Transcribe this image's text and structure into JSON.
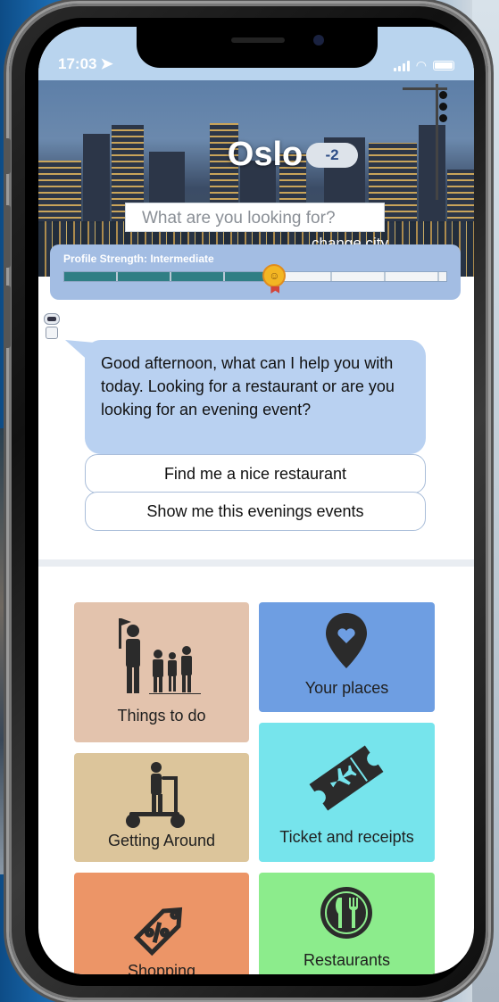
{
  "status": {
    "time": "17:03"
  },
  "header": {
    "city": "Oslo",
    "weather_temp": "-2",
    "search_placeholder": "What are you looking for?",
    "change_city": "change city"
  },
  "profile": {
    "label": "Profile Strength: Intermediate",
    "progress_fraction": 0.55
  },
  "chat": {
    "message": "Good afternoon, what can I help you with today. Looking for a restaurant or are you looking for an evening event?",
    "replies": [
      {
        "label": "Find me a nice restaurant"
      },
      {
        "label": "Show me this evenings events"
      }
    ]
  },
  "tiles": [
    {
      "label": "Things to do",
      "icon": "people-tour-icon",
      "color": "#e3c3ad"
    },
    {
      "label": "Your places",
      "icon": "map-pin-heart-icon",
      "color": "#6e9ee2"
    },
    {
      "label": "Getting Around",
      "icon": "scooter-icon",
      "color": "#dcc59b"
    },
    {
      "label": "Ticket and receipts",
      "icon": "plane-ticket-icon",
      "color": "#76e4ec"
    },
    {
      "label": "Shopping",
      "icon": "percent-tag-icon",
      "color": "#ec9567"
    },
    {
      "label": "Restaurants",
      "icon": "plate-cutlery-icon",
      "color": "#8cec8c"
    }
  ]
}
